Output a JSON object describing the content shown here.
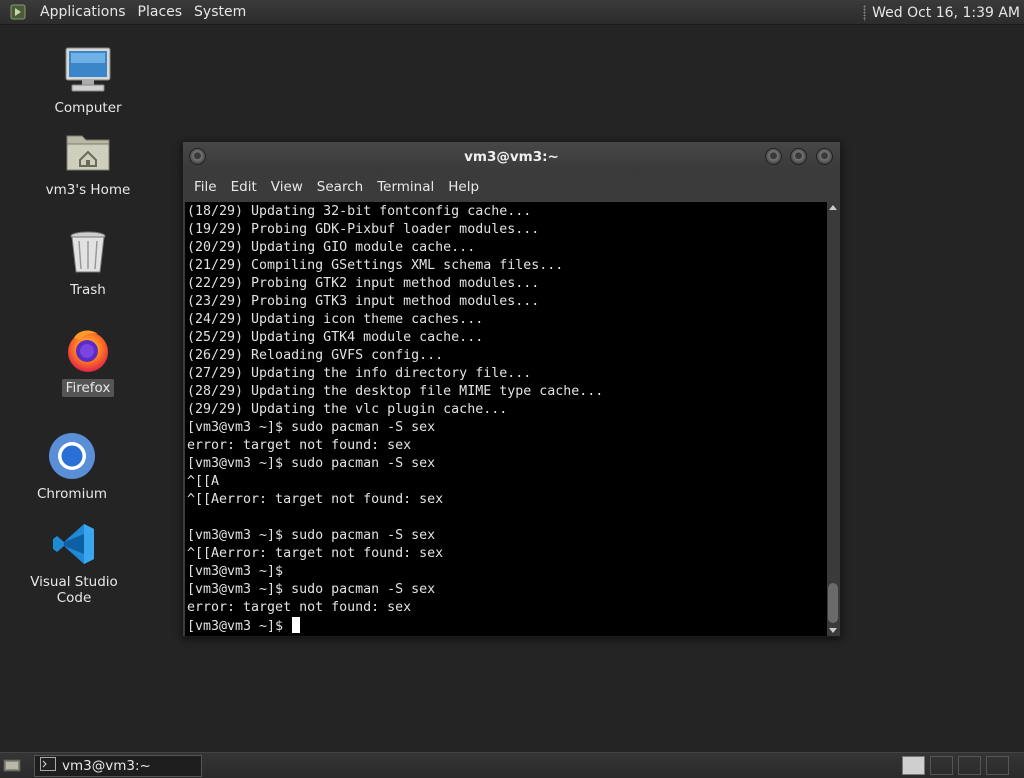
{
  "top_panel": {
    "menus": [
      "Applications",
      "Places",
      "System"
    ],
    "clock": "Wed Oct 16,  1:39 AM"
  },
  "desktop_icons": [
    {
      "label": "Computer",
      "icon": "computer-icon"
    },
    {
      "label": "vm3's Home",
      "icon": "home-folder-icon"
    },
    {
      "label": "Trash",
      "icon": "trash-icon"
    },
    {
      "label": "Firefox",
      "icon": "firefox-icon"
    },
    {
      "label": "Chromium",
      "icon": "chromium-icon"
    },
    {
      "label": "Visual Studio Code",
      "icon": "vscode-icon"
    }
  ],
  "terminal": {
    "title": "vm3@vm3:~",
    "menus": [
      "File",
      "Edit",
      "View",
      "Search",
      "Terminal",
      "Help"
    ],
    "lines": [
      "(18/29) Updating 32-bit fontconfig cache...",
      "(19/29) Probing GDK-Pixbuf loader modules...",
      "(20/29) Updating GIO module cache...",
      "(21/29) Compiling GSettings XML schema files...",
      "(22/29) Probing GTK2 input method modules...",
      "(23/29) Probing GTK3 input method modules...",
      "(24/29) Updating icon theme caches...",
      "(25/29) Updating GTK4 module cache...",
      "(26/29) Reloading GVFS config...",
      "(27/29) Updating the info directory file...",
      "(28/29) Updating the desktop file MIME type cache...",
      "(29/29) Updating the vlc plugin cache...",
      "[vm3@vm3 ~]$ sudo pacman -S sex",
      "error: target not found: sex",
      "[vm3@vm3 ~]$ sudo pacman -S sex",
      "^[[A",
      "^[[Aerror: target not found: sex",
      "",
      "[vm3@vm3 ~]$ sudo pacman -S sex",
      "^[[Aerror: target not found: sex",
      "[vm3@vm3 ~]$",
      "[vm3@vm3 ~]$ sudo pacman -S sex",
      "error: target not found: sex",
      "[vm3@vm3 ~]$ "
    ]
  },
  "bottom_panel": {
    "task_label": "vm3@vm3:~"
  }
}
